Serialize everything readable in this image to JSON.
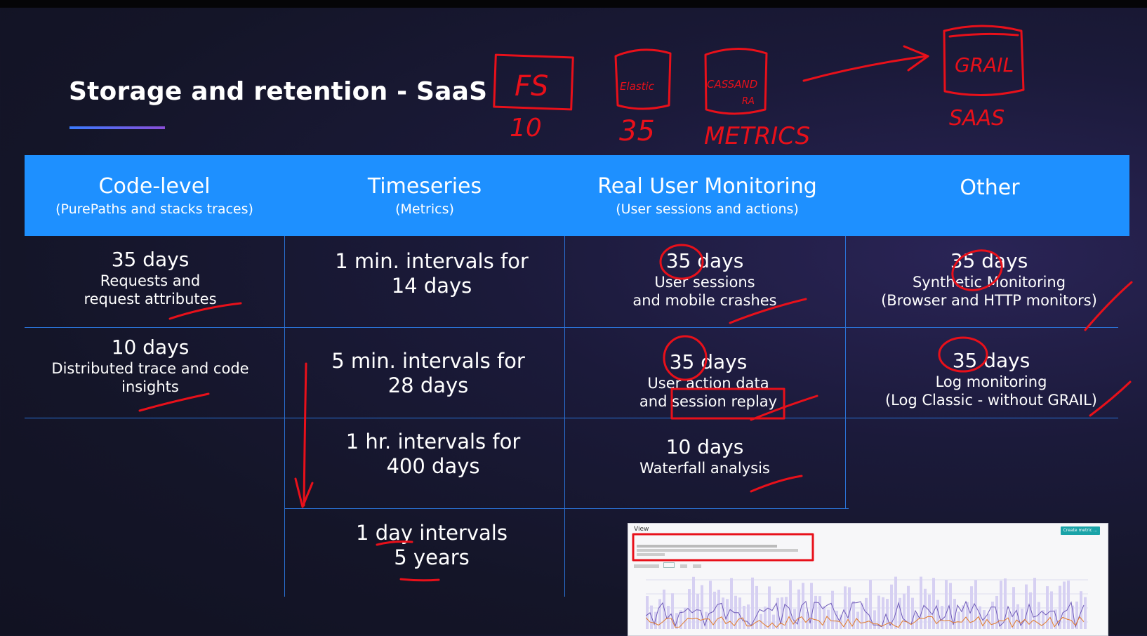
{
  "slide": {
    "title": "Storage and retention - SaaS",
    "columns": [
      {
        "title": "Code-level",
        "subtitle": "(PurePaths and stacks traces)"
      },
      {
        "title": "Timeseries",
        "subtitle": "(Metrics)"
      },
      {
        "title": "Real User Monitoring",
        "subtitle": "(User sessions and actions)"
      },
      {
        "title": "Other",
        "subtitle": ""
      }
    ],
    "code_level": [
      {
        "days": "35 days",
        "line1": "Requests and",
        "line2": "request attributes"
      },
      {
        "days": "10 days",
        "line1": "Distributed trace and code",
        "line2": "insights"
      }
    ],
    "timeseries": [
      {
        "line1": "1 min. intervals for",
        "line2": "14 days"
      },
      {
        "line1": "5 min. intervals for",
        "line2": "28 days"
      },
      {
        "line1": "1 hr. intervals for",
        "line2": "400 days"
      },
      {
        "line1": "1 day intervals",
        "line2": "5 years"
      }
    ],
    "rum": [
      {
        "days": "35 days",
        "line1": "User sessions",
        "line2": "and mobile crashes"
      },
      {
        "days": "35 days",
        "line1": "User action data",
        "line2": "and session replay"
      },
      {
        "days": "10 days",
        "line1": "Waterfall analysis",
        "line2": ""
      }
    ],
    "other": [
      {
        "days": "35 days",
        "line1": "Synthetic Monitoring",
        "line2": "(Browser and HTTP monitors)"
      },
      {
        "days": "35 days",
        "line1": "Log monitoring",
        "line2": "(Log Classic - without GRAIL)"
      }
    ]
  },
  "annotations": {
    "fs": "FS",
    "fs_num": "10",
    "elastic": "Elastic",
    "elastic_num": "35",
    "cassandra_line1": "CASSAND",
    "cassandra_line2": "RA",
    "metrics": "METRICS",
    "grail": "GRAIL",
    "saas": "SAAS"
  },
  "thumbnail": {
    "view_label": "View",
    "button_label": "Create metric ..."
  },
  "colors": {
    "header_band": "#1e90ff",
    "grid_line": "#2a72d6",
    "annotation_ink": "#e8101a",
    "background": "#151629"
  }
}
